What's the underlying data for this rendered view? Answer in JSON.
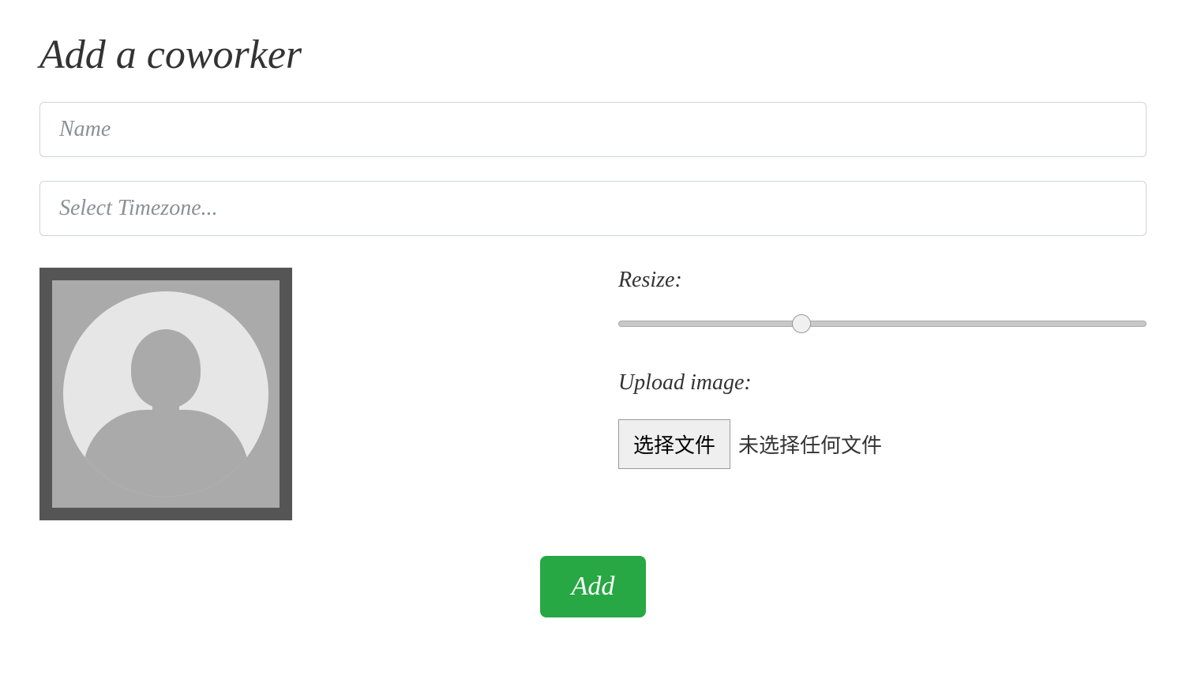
{
  "heading": "Add a coworker",
  "form": {
    "name_placeholder": "Name",
    "timezone_placeholder": "Select Timezone..."
  },
  "controls": {
    "resize_label": "Resize:",
    "upload_label": "Upload image:",
    "file_button": "选择文件",
    "file_status": "未选择任何文件"
  },
  "buttons": {
    "add": "Add"
  }
}
